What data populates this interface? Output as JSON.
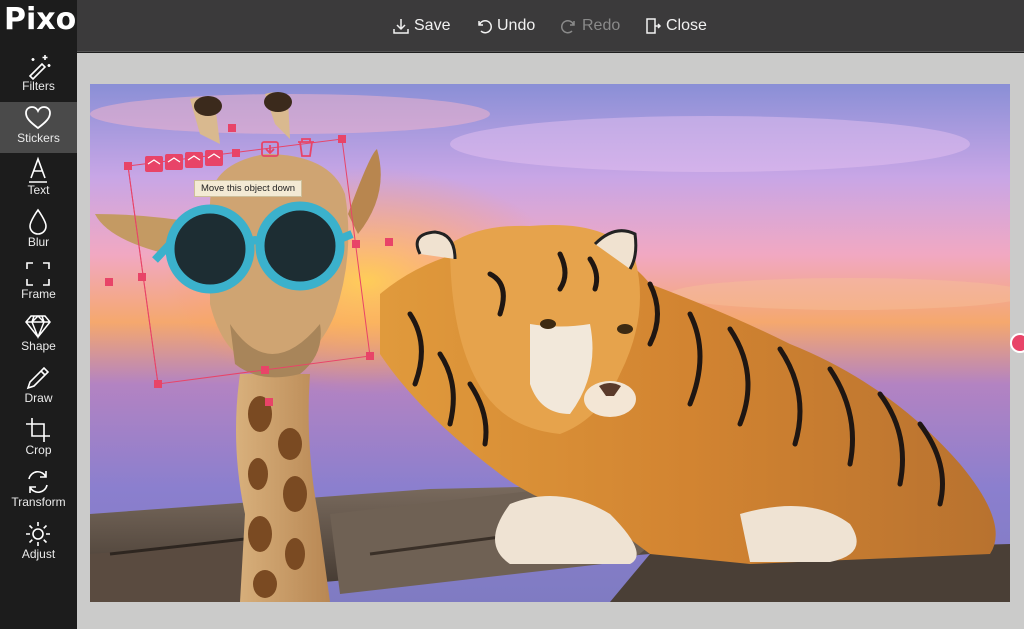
{
  "app": {
    "logo_text": "Pixo"
  },
  "sidebar": {
    "items": [
      {
        "label": "Filters",
        "icon": "magic-wand-icon",
        "active": false
      },
      {
        "label": "Stickers",
        "icon": "heart-icon",
        "active": true
      },
      {
        "label": "Text",
        "icon": "text-icon",
        "active": false
      },
      {
        "label": "Blur",
        "icon": "droplet-icon",
        "active": false
      },
      {
        "label": "Frame",
        "icon": "frame-icon",
        "active": false
      },
      {
        "label": "Shape",
        "icon": "diamond-icon",
        "active": false
      },
      {
        "label": "Draw",
        "icon": "pencil-icon",
        "active": false
      },
      {
        "label": "Crop",
        "icon": "crop-icon",
        "active": false
      },
      {
        "label": "Transform",
        "icon": "transform-icon",
        "active": false
      },
      {
        "label": "Adjust",
        "icon": "sun-icon",
        "active": false
      }
    ]
  },
  "toolbar": {
    "save_label": "Save",
    "undo_label": "Undo",
    "redo_label": "Redo",
    "close_label": "Close"
  },
  "canvas": {
    "tooltip": "Move this object down",
    "sticker_controls": [
      "layer-up-icon",
      "layer-down-icon",
      "delete-icon"
    ],
    "accent_color": "#e84468"
  }
}
